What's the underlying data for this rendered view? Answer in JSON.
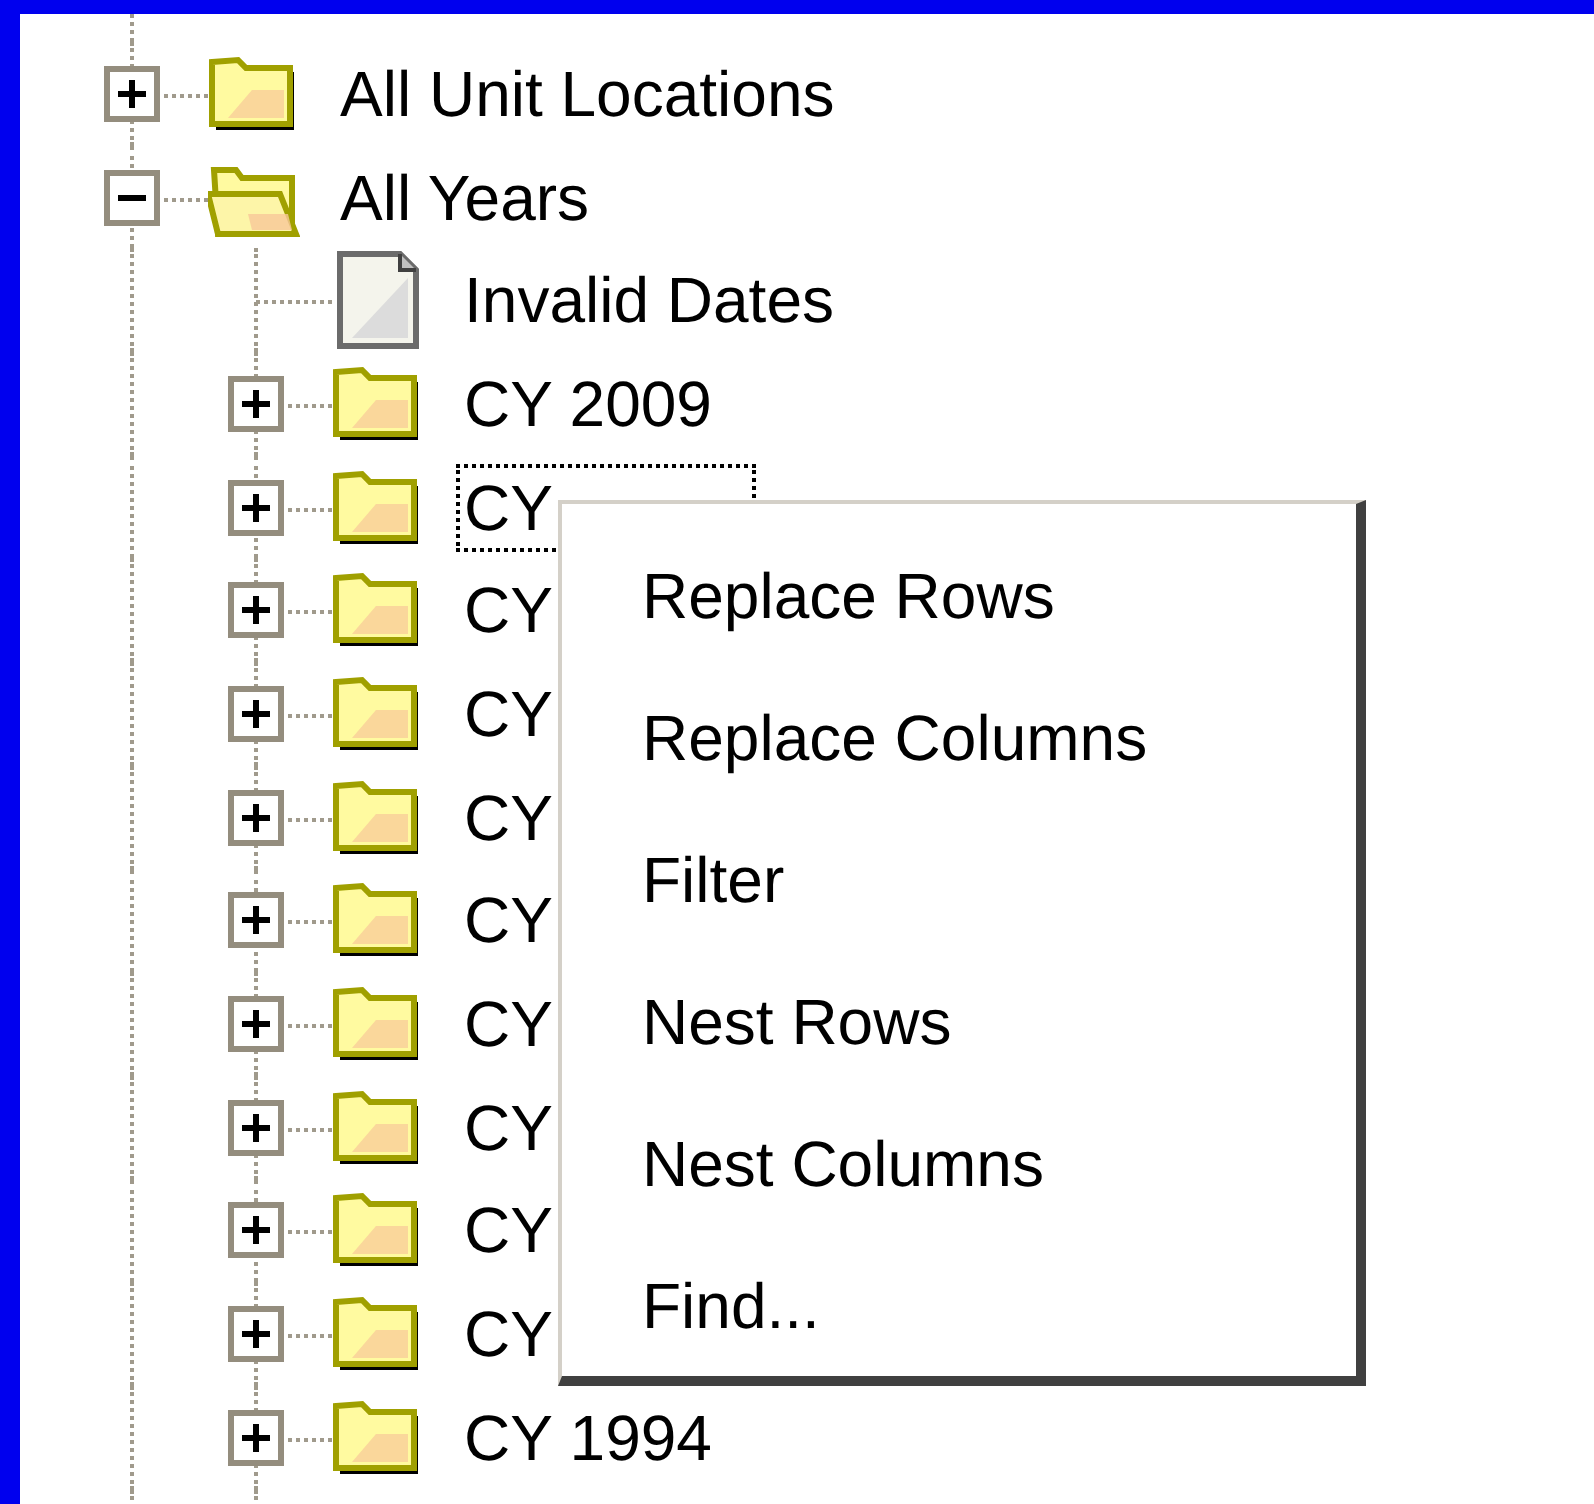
{
  "tree": [
    {
      "label": "All Unit Locations",
      "kind": "folder",
      "expanded": false,
      "selected": false
    },
    {
      "label": "All Years",
      "kind": "folder",
      "expanded": true,
      "selected": false,
      "children": [
        {
          "label": "Invalid Dates",
          "kind": "document",
          "selected": false
        },
        {
          "label": "CY 2009",
          "kind": "folder",
          "expanded": false,
          "selected": false
        },
        {
          "label": "CY",
          "kind": "folder",
          "expanded": false,
          "selected": true
        },
        {
          "label": "CY",
          "kind": "folder",
          "expanded": false,
          "selected": false
        },
        {
          "label": "CY",
          "kind": "folder",
          "expanded": false,
          "selected": false
        },
        {
          "label": "CY",
          "kind": "folder",
          "expanded": false,
          "selected": false
        },
        {
          "label": "CY",
          "kind": "folder",
          "expanded": false,
          "selected": false
        },
        {
          "label": "CY",
          "kind": "folder",
          "expanded": false,
          "selected": false
        },
        {
          "label": "CY",
          "kind": "folder",
          "expanded": false,
          "selected": false
        },
        {
          "label": "CY",
          "kind": "folder",
          "expanded": false,
          "selected": false
        },
        {
          "label": "CY",
          "kind": "folder",
          "expanded": false,
          "selected": false
        },
        {
          "label": "CY 1994",
          "kind": "folder",
          "expanded": false,
          "selected": false
        }
      ]
    }
  ],
  "context_menu": {
    "items": [
      "Replace Rows",
      "Replace Columns",
      "Filter",
      "Nest Rows",
      "Nest Columns",
      "Find..."
    ]
  }
}
